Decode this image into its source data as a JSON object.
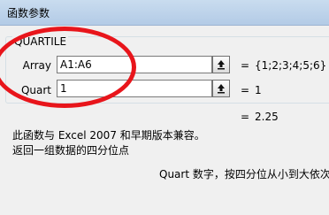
{
  "window": {
    "title": "函数参数"
  },
  "function": {
    "name": "QUARTILE"
  },
  "args": [
    {
      "label": "Array",
      "value": "A1:A6",
      "result": "{1;2;3;4;5;6}"
    },
    {
      "label": "Quart",
      "value": "1",
      "result": "1"
    }
  ],
  "equals": "=",
  "formula_result": "2.25",
  "description": {
    "line1": "此函数与 Excel 2007 和早期版本兼容。",
    "line2": "返回一组数据的四分位点"
  },
  "arg_help": "Quart  数字，按四分位从小到大依次",
  "colors": {
    "annotation": "#e8151b"
  },
  "icons": {
    "collapse": "collapse-dialog-icon"
  }
}
